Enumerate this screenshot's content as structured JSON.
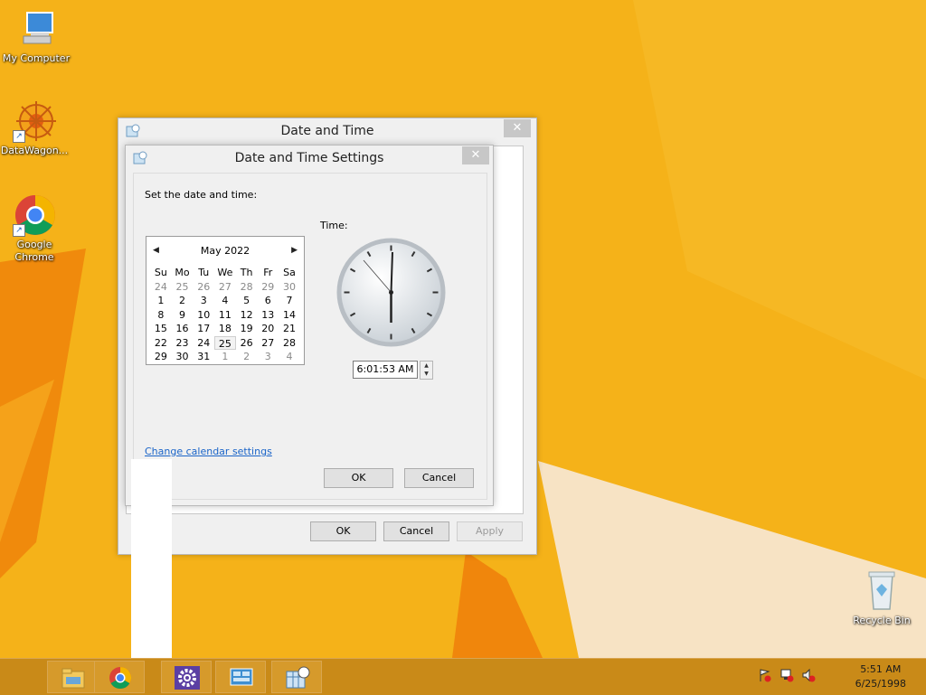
{
  "desktop": {
    "icons": [
      {
        "label": "My Computer"
      },
      {
        "label": "DataWagon..."
      },
      {
        "label": "Google Chrome"
      },
      {
        "label": "Recycle Bin"
      }
    ]
  },
  "outer_window": {
    "title": "Date and Time",
    "close": "✕",
    "buttons": {
      "ok": "OK",
      "cancel": "Cancel",
      "apply": "Apply"
    }
  },
  "inner_dialog": {
    "title": "Date and Time Settings",
    "close": "✕",
    "set_label": "Set the date and time:",
    "time_label": "Time:",
    "calendar": {
      "month_label": "May 2022",
      "weekdays": [
        "Su",
        "Mo",
        "Tu",
        "We",
        "Th",
        "Fr",
        "Sa"
      ],
      "weeks": [
        [
          "24",
          "25",
          "26",
          "27",
          "28",
          "29",
          "30"
        ],
        [
          "1",
          "2",
          "3",
          "4",
          "5",
          "6",
          "7"
        ],
        [
          "8",
          "9",
          "10",
          "11",
          "12",
          "13",
          "14"
        ],
        [
          "15",
          "16",
          "17",
          "18",
          "19",
          "20",
          "21"
        ],
        [
          "22",
          "23",
          "24",
          "25",
          "26",
          "27",
          "28"
        ],
        [
          "29",
          "30",
          "31",
          "1",
          "2",
          "3",
          "4"
        ]
      ],
      "selected_day": "25"
    },
    "time_value": "6:01:53 AM",
    "change_calendar_link": "Change calendar settings",
    "buttons": {
      "ok": "OK",
      "cancel": "Cancel"
    }
  },
  "taskbar": {
    "time": "5:51 AM",
    "date": "6/25/1998"
  },
  "colors": {
    "desktop_bg": "#f5b219",
    "taskbar": "#c98a18",
    "link": "#1a64c8"
  }
}
